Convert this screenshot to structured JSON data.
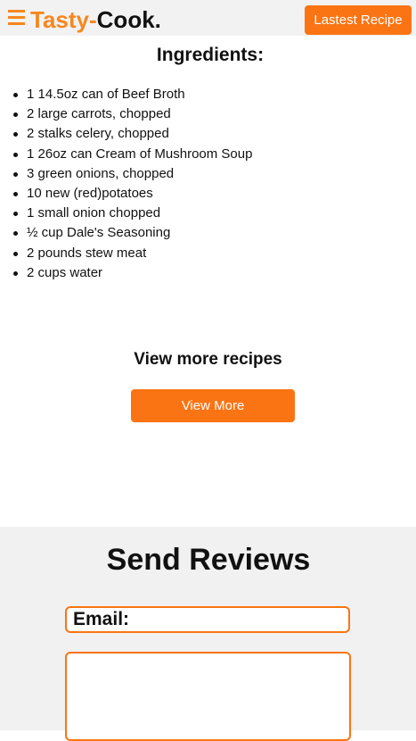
{
  "header": {
    "logo_part1": "Tasty-",
    "logo_part2": "Cook.",
    "latest_button": "Lastest Recipe",
    "menu_icon": "hamburger-menu-icon"
  },
  "ingredients": {
    "title": "Ingredients:",
    "items": [
      "1 14.5oz can of Beef Broth",
      "2 large carrots, chopped",
      "2 stalks celery, chopped",
      "1 26oz can Cream of Mushroom Soup",
      "3 green onions, chopped",
      "10 new (red)potatoes",
      "1 small onion chopped",
      "½ cup Dale's Seasoning",
      "2 pounds stew meat",
      "2 cups water"
    ]
  },
  "view_more": {
    "title": "View more recipes",
    "button": "View More"
  },
  "reviews": {
    "title": "Send Reviews",
    "email_placeholder": "Email:",
    "review_value": ""
  },
  "colors": {
    "accent": "#fb7414",
    "logo_orange": "#f7871f",
    "header_bg": "#f2f2f2",
    "reviews_bg": "#f1f1f1"
  }
}
